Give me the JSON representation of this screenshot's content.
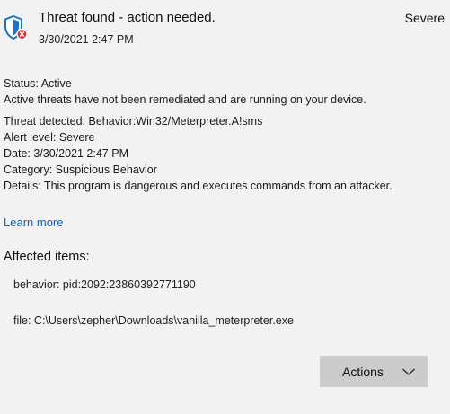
{
  "header": {
    "title": "Threat found - action needed.",
    "timestamp": "3/30/2021 2:47 PM",
    "severity": "Severe",
    "icon": "shield-error-icon"
  },
  "status": {
    "label": "Status:",
    "value": "Active",
    "description": "Active threats have not been remediated and are running on your device."
  },
  "details": {
    "threat_detected": "Threat detected: Behavior:Win32/Meterpreter.A!sms",
    "alert_level": "Alert level: Severe",
    "date": "Date: 3/30/2021 2:47 PM",
    "category": "Category: Suspicious Behavior",
    "details": "Details: This program is dangerous and executes commands from an attacker."
  },
  "learn_more": "Learn more",
  "affected": {
    "heading": "Affected items:",
    "items": [
      "behavior: pid:2092:23860392771190",
      "file: C:\\Users\\zepher\\Downloads\\vanilla_meterpreter.exe"
    ]
  },
  "actions": {
    "label": "Actions",
    "icon": "chevron-down-icon"
  },
  "colors": {
    "background": "#f2f2f2",
    "link": "#0a64b4",
    "shield": "#1a73c8",
    "error_badge": "#d13438",
    "button": "#cccccc"
  }
}
